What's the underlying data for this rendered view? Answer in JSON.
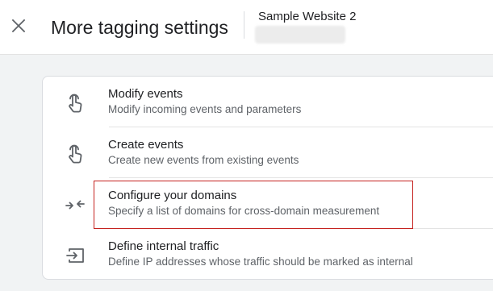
{
  "header": {
    "title": "More tagging settings",
    "property_name": "Sample Website 2",
    "close_icon": "close-icon"
  },
  "settings": {
    "items": [
      {
        "title": "Modify events",
        "subtitle": "Modify incoming events and parameters",
        "icon": "touch-icon"
      },
      {
        "title": "Create events",
        "subtitle": "Create new events from existing events",
        "icon": "touch-icon"
      },
      {
        "title": "Configure your domains",
        "subtitle": "Specify a list of domains for cross-domain measurement",
        "icon": "merge-arrows-icon"
      },
      {
        "title": "Define internal traffic",
        "subtitle": "Define IP addresses whose traffic should be marked as internal",
        "icon": "input-icon"
      }
    ]
  },
  "colors": {
    "background": "#f1f3f4",
    "text_primary": "#202124",
    "text_secondary": "#5f6368",
    "highlight": "#c5221f"
  }
}
